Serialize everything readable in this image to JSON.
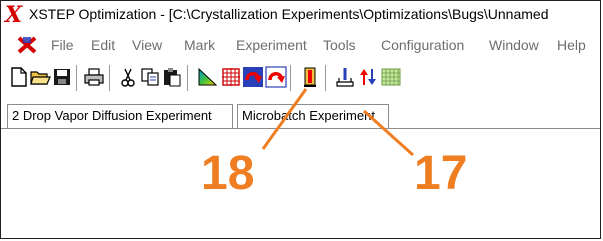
{
  "window": {
    "title": "XSTEP Optimization - [C:\\Crystallization Experiments\\Optimizations\\Bugs\\Unnamed"
  },
  "menu": {
    "items": [
      {
        "label": "File"
      },
      {
        "label": "Edit"
      },
      {
        "label": "View"
      },
      {
        "label": "Mark"
      },
      {
        "label": "Experiment"
      },
      {
        "label": "Tools"
      },
      {
        "label": "Configuration"
      },
      {
        "label": "Window"
      },
      {
        "label": "Help"
      }
    ]
  },
  "toolbar": {
    "icons": [
      "new-document-icon",
      "open-folder-icon",
      "save-icon",
      "print-icon",
      "cut-icon",
      "copy-icon",
      "paste-icon",
      "gradient-triangle-icon",
      "grid-target-icon",
      "red-arrow-icon-a",
      "red-arrow-icon-b",
      "thermometer-icon",
      "pipette-icon",
      "up-down-arrows-icon",
      "plate-grid-icon"
    ]
  },
  "tabs": [
    {
      "label": "2 Drop Vapor Diffusion Experiment"
    },
    {
      "label": "Microbatch Experiment"
    }
  ],
  "annotations": [
    {
      "number": "18"
    },
    {
      "number": "17"
    }
  ],
  "colors": {
    "callout": "#ef7d21",
    "app_icon": "#d40000"
  }
}
